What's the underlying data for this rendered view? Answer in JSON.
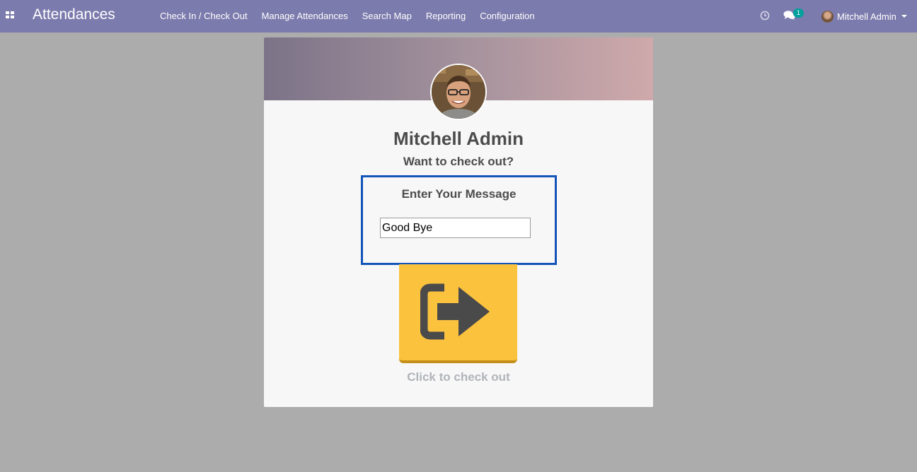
{
  "navbar": {
    "app_title": "Attendances",
    "menu": [
      {
        "label": "Check In / Check Out"
      },
      {
        "label": "Manage Attendances"
      },
      {
        "label": "Search Map"
      },
      {
        "label": "Reporting"
      },
      {
        "label": "Configuration"
      }
    ],
    "chat_badge": "1",
    "user_name": "Mitchell Admin",
    "icons": [
      "apps-icon",
      "clock-icon",
      "chat-icon",
      "caret-down-icon"
    ],
    "accent_color": "#7c7bad"
  },
  "kiosk": {
    "employee_name": "Mitchell Admin",
    "question": "Want to check out?",
    "message_label": "Enter Your Message",
    "message_value": "Good Bye",
    "button_icon": "sign-out-icon",
    "button_color": "#fbc23e",
    "caption": "Click to check out"
  }
}
